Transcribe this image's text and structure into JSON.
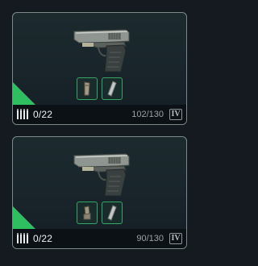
{
  "colors": {
    "background": "#151a21",
    "card_border": "#7b8a86",
    "rarity_accent": "#2fbf61",
    "mod_border": "#36a866",
    "footer": "#0c1116"
  },
  "weapons": [
    {
      "icon": "pistol-icon",
      "mods": [
        "magazine-mod-icon",
        "suppressor-mod-icon"
      ],
      "ammo": "0/22",
      "durability": "102/130",
      "tier": "IV"
    },
    {
      "icon": "pistol-icon",
      "mods": [
        "muzzle-brake-mod-icon",
        "suppressor-mod-icon"
      ],
      "ammo": "0/22",
      "durability": "90/130",
      "tier": "IV"
    }
  ]
}
